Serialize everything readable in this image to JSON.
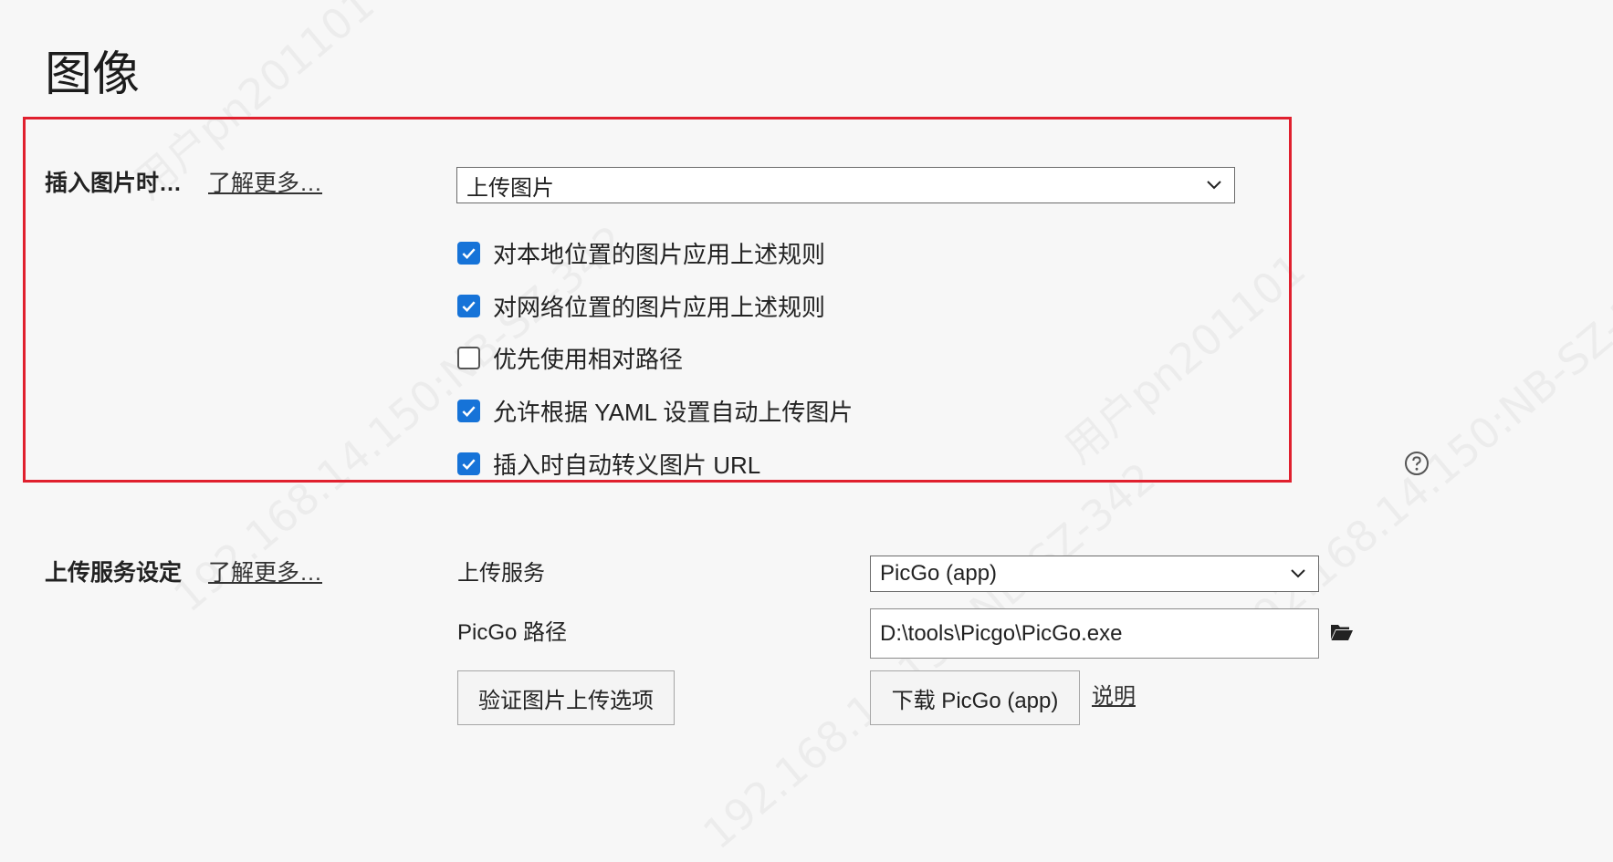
{
  "page": {
    "title": "图像"
  },
  "insert_section": {
    "label": "插入图片时…",
    "learn_more": "了解更多…",
    "action_select": {
      "value": "上传图片"
    },
    "options": [
      {
        "label": "对本地位置的图片应用上述规则",
        "checked": true
      },
      {
        "label": "对网络位置的图片应用上述规则",
        "checked": true
      },
      {
        "label": "优先使用相对路径",
        "checked": false
      },
      {
        "label": "允许根据 YAML 设置自动上传图片",
        "checked": true
      },
      {
        "label": "插入时自动转义图片 URL",
        "checked": true
      }
    ]
  },
  "upload_section": {
    "label": "上传服务设定",
    "learn_more": "了解更多…",
    "service_label": "上传服务",
    "service_select": {
      "value": "PicGo (app)"
    },
    "path_label": "PicGo 路径",
    "path_value": "D:\\tools\\Picgo\\PicGo.exe",
    "verify_button": "验证图片上传选项",
    "download_button": "下载 PicGo (app)",
    "explain_link": "说明"
  },
  "watermark": {
    "lines": [
      "192.168.14.150:NB-SZ-342",
      "用户pn201101",
      "192.168.14.150:NB-SZ-342",
      "用户pn201101",
      "192.168.14.150:NB-SZ-342"
    ]
  },
  "colors": {
    "accent": "#1673d8",
    "highlight": "#e0202e",
    "background": "#f7f7f7"
  },
  "icons": {
    "help": "question-circle-icon",
    "folder": "folder-icon",
    "dropdown": "chevron-down-icon",
    "check": "checkmark-icon"
  }
}
